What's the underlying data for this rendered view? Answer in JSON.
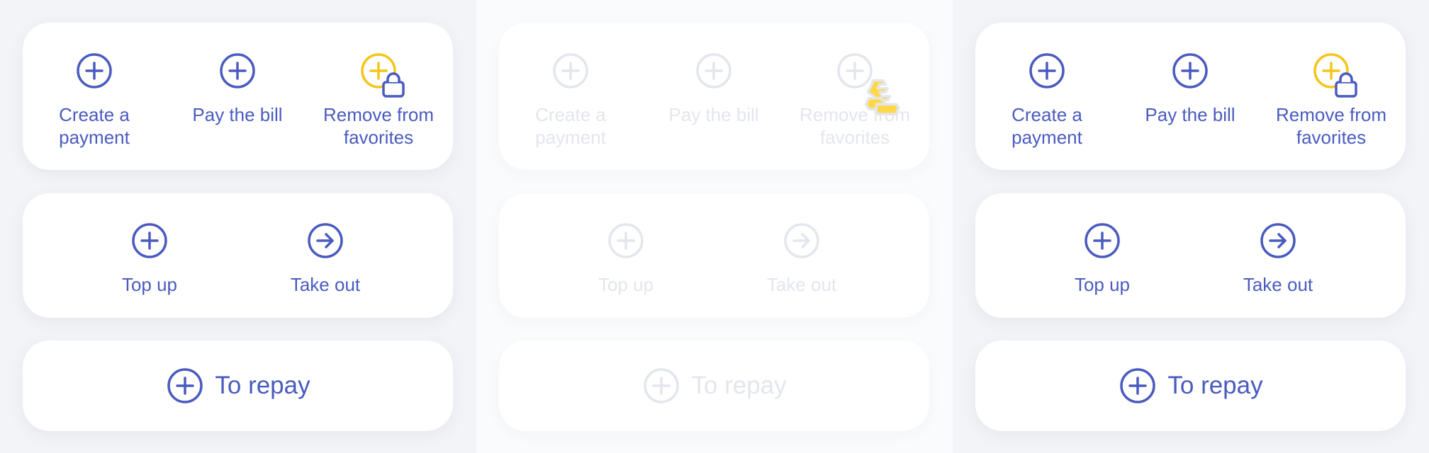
{
  "colors": {
    "primary": "#4a5bbf",
    "favorite": "#f5c518",
    "disabled": "#e4e6ee",
    "card": "#ffffff",
    "background": "#f3f4f7"
  },
  "panels": [
    {
      "state": "enabled",
      "actions": [
        {
          "label": "Create a\npayment",
          "icon": "plus-circle-icon"
        },
        {
          "label": "Pay the bill",
          "icon": "plus-circle-icon"
        },
        {
          "label": "Remove from\nfavorites",
          "icon": "plus-circle-lock-icon"
        }
      ],
      "account_actions": [
        {
          "label": "Top up",
          "icon": "plus-circle-icon"
        },
        {
          "label": "Take out",
          "icon": "arrow-right-circle-icon"
        }
      ],
      "repay": {
        "label": "To repay",
        "icon": "plus-circle-icon"
      }
    },
    {
      "state": "disabled",
      "actions": [
        {
          "label": "Create a\npayment",
          "icon": "plus-circle-icon"
        },
        {
          "label": "Pay the bill",
          "icon": "plus-circle-icon"
        },
        {
          "label": "Remove from\nfavorites",
          "icon": "loading-busy-icon"
        }
      ],
      "account_actions": [
        {
          "label": "Top up",
          "icon": "plus-circle-icon"
        },
        {
          "label": "Take out",
          "icon": "arrow-right-circle-icon"
        }
      ],
      "repay": {
        "label": "To repay",
        "icon": "plus-circle-icon"
      }
    },
    {
      "state": "enabled",
      "actions": [
        {
          "label": "Create a\npayment",
          "icon": "plus-circle-icon"
        },
        {
          "label": "Pay the bill",
          "icon": "plus-circle-icon"
        },
        {
          "label": "Remove from\nfavorites",
          "icon": "plus-circle-lock-icon"
        }
      ],
      "account_actions": [
        {
          "label": "Top up",
          "icon": "plus-circle-icon"
        },
        {
          "label": "Take out",
          "icon": "arrow-right-circle-icon"
        }
      ],
      "repay": {
        "label": "To repay",
        "icon": "plus-circle-icon"
      }
    }
  ]
}
